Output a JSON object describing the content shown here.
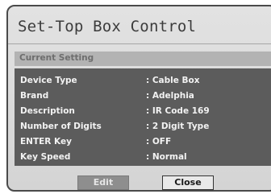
{
  "dialog": {
    "title": "Set-Top Box Control",
    "section_label": "Current Setting",
    "settings": [
      {
        "label": "Device Type",
        "value": ": Cable Box"
      },
      {
        "label": "Brand",
        "value": ": Adelphia"
      },
      {
        "label": "Description",
        "value": ": IR Code 169"
      },
      {
        "label": "Number of Digits",
        "value": ": 2 Digit Type"
      },
      {
        "label": "ENTER Key",
        "value": ": OFF"
      },
      {
        "label": "Key Speed",
        "value": ": Normal"
      }
    ],
    "buttons": {
      "edit_label": "Edit",
      "close_label": "Close"
    }
  },
  "colors": {
    "dialog_background": "#dcdcdc",
    "panel_background": "#5c5c5c",
    "panel_text": "#f2f2f2",
    "edit_button_background": "#8e8e8e",
    "close_button_background": "#e9e9e9"
  }
}
